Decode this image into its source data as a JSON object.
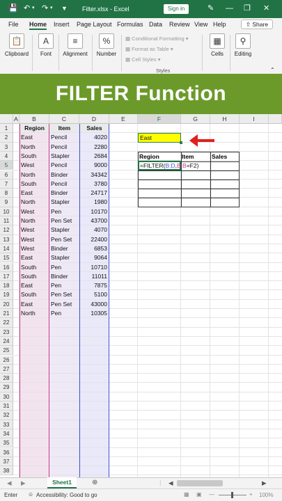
{
  "titlebar": {
    "filename": "Filter.xlsx",
    "separator": " - ",
    "app": "Excel",
    "signin_label": "Sign in"
  },
  "menu": {
    "items": [
      "File",
      "Home",
      "Insert",
      "Page Layout",
      "Formulas",
      "Data",
      "Review",
      "View",
      "Help"
    ],
    "active": "Home",
    "share_label": "Share"
  },
  "ribbon": {
    "clipboard": "Clipboard",
    "font": "Font",
    "alignment": "Alignment",
    "number": "Number",
    "conditional_formatting": "Conditional Formatting",
    "format_as_table": "Format as Table",
    "cell_styles": "Cell Styles",
    "styles_group": "Styles",
    "cells": "Cells",
    "editing": "Editing"
  },
  "banner": {
    "text": "FILTER Function"
  },
  "grid": {
    "columns": [
      "A",
      "B",
      "C",
      "D",
      "E",
      "F",
      "G",
      "H",
      "I"
    ],
    "rows": [
      "1",
      "2",
      "3",
      "4",
      "5",
      "6",
      "7",
      "8",
      "9",
      "10",
      "11",
      "12",
      "13",
      "14",
      "15",
      "16",
      "17",
      "18",
      "19",
      "20",
      "21",
      "22",
      "23",
      "24",
      "25",
      "26",
      "27",
      "28",
      "29",
      "30",
      "31",
      "32",
      "33",
      "34",
      "35",
      "36",
      "37",
      "38"
    ],
    "headers": {
      "region": "Region",
      "item": "Item",
      "sales": "Sales"
    },
    "data": [
      [
        "East",
        "Pencil",
        "4020"
      ],
      [
        "North",
        "Pencil",
        "2280"
      ],
      [
        "South",
        "Stapler",
        "2684"
      ],
      [
        "West",
        "Pencil",
        "9000"
      ],
      [
        "North",
        "Binder",
        "34342"
      ],
      [
        "South",
        "Pencil",
        "3780"
      ],
      [
        "East",
        "Binder",
        "24717"
      ],
      [
        "North",
        "Stapler",
        "1980"
      ],
      [
        "West",
        "Pen",
        "10170"
      ],
      [
        "North",
        "Pen Set",
        "43700"
      ],
      [
        "West",
        "Stapler",
        "4070"
      ],
      [
        "West",
        "Pen Set",
        "22400"
      ],
      [
        "West",
        "Binder",
        "6853"
      ],
      [
        "East",
        "Stapler",
        "9064"
      ],
      [
        "South",
        "Pen",
        "10710"
      ],
      [
        "South",
        "Binder",
        "11011"
      ],
      [
        "East",
        "Pen",
        "7875"
      ],
      [
        "South",
        "Pen Set",
        "5100"
      ],
      [
        "East",
        "Pen Set",
        "43000"
      ],
      [
        "North",
        "Pen",
        "10305"
      ]
    ],
    "criteria_value": "East",
    "output_headers": {
      "region": "Region",
      "item": "Item",
      "sales": "Sales"
    },
    "formula": {
      "prefix": "=FILTER(",
      "range_b_d": "B:D",
      "comma": ",",
      "range_b_b": "B:B",
      "eq": "=",
      "ref_f2": "F2",
      "suffix": ")"
    }
  },
  "sheets": {
    "tab": "Sheet1"
  },
  "status": {
    "mode": "Enter",
    "accessibility": "Accessibility: Good to go",
    "zoom": "100%"
  },
  "colors": {
    "excel_green": "#217346",
    "banner": "#6b9a2a",
    "highlight": "#ffff00",
    "arrow": "#e02020"
  }
}
